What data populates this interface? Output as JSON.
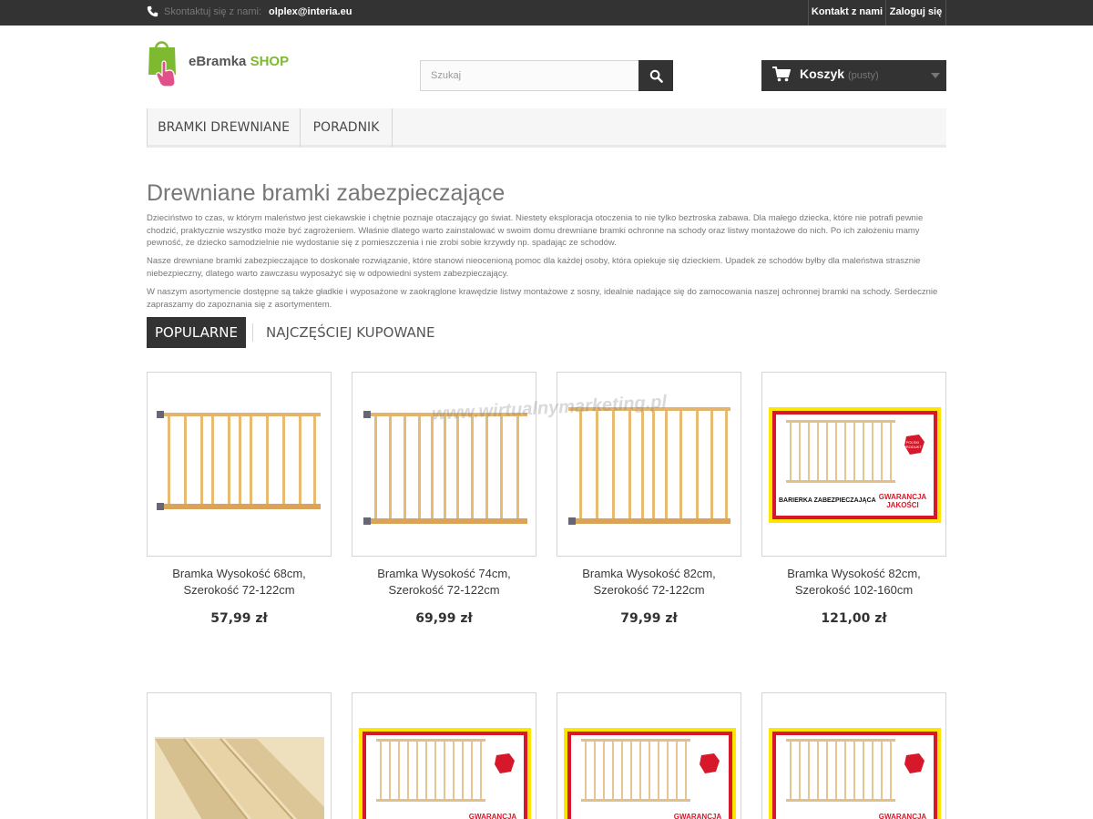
{
  "topbar": {
    "contact_label": "Skontaktuj się z nami:",
    "contact_email": "olplex@interia.eu",
    "contact_link": "Kontakt z nami",
    "login_link": "Zaloguj się"
  },
  "logo": {
    "text_main": "eBramka",
    "text_shop": "SHOP"
  },
  "search": {
    "placeholder": "Szukaj"
  },
  "cart": {
    "label": "Koszyk",
    "status": "(pusty)"
  },
  "menu": {
    "items": [
      "BRAMKI DREWNIANE",
      "PORADNIK"
    ]
  },
  "page": {
    "title": "Drewniane bramki zabezpieczające",
    "paragraphs": [
      "Dzieciństwo to czas, w którym maleństwo jest ciekawskie i chętnie poznaje otaczający go świat. Niestety eksploracja otoczenia to nie tylko beztroska zabawa. Dla małego dziecka, które nie potrafi pewnie chodzić, praktycznie wszystko może być zagrożeniem. Właśnie dlatego warto zainstalować w swoim domu drewniane bramki ochronne na schody oraz listwy montażowe do nich. Po ich założeniu mamy pewność, że dziecko samodzielnie nie wydostanie się z pomieszczenia i nie zrobi sobie krzywdy np. spadając ze schodów.",
      "Nasze drewniane bramki zabezpieczające to doskonałe rozwiązanie, które stanowi nieocenioną pomoc dla każdej osoby, która opiekuje się dzieckiem. Upadek ze schodów byłby dla maleństwa strasznie niebezpieczny, dlatego warto zawczasu wyposażyć się w odpowiedni system zabezpieczający.",
      "W naszym asortymencie dostępne są także gładkie i wyposażone w zaokrąglone krawędzie listwy montażowe z sosny, idealnie nadające się do zamocowania naszej ochronnej bramki na schody. Serdecznie zapraszamy do zapoznania się z asortymentem."
    ]
  },
  "tabs": [
    "POPULARNE",
    "NAJCZĘŚCIEJ KUPOWANE"
  ],
  "watermark": "www.wirtualnymarketing.pl",
  "products": [
    {
      "name_line1": "Bramka Wysokość 68cm,",
      "name_line2": "Szerokość 72-122cm",
      "price": "57,99 zł"
    },
    {
      "name_line1": "Bramka Wysokość 74cm,",
      "name_line2": "Szerokość 72-122cm",
      "price": "69,99 zł"
    },
    {
      "name_line1": "Bramka Wysokość 82cm,",
      "name_line2": "Szerokość 72-122cm",
      "price": "79,99 zł"
    },
    {
      "name_line1": "Bramka Wysokość 82cm,",
      "name_line2": "Szerokość 102-160cm",
      "price": "121,00 zł"
    }
  ],
  "badge": {
    "left_text": "BARIERKA ZABEZPIECZAJĄCA",
    "right_line1": "GWARANCJA",
    "right_line2": "JAKOŚCI",
    "seal_line1": "POLSKI",
    "seal_line2": "PRODUKT"
  },
  "colors": {
    "accent_dark": "#333333",
    "logo_green": "#7dba32",
    "badge_red": "#d7182a",
    "badge_yellow": "#ffe500",
    "wood": "#e3b46b"
  }
}
